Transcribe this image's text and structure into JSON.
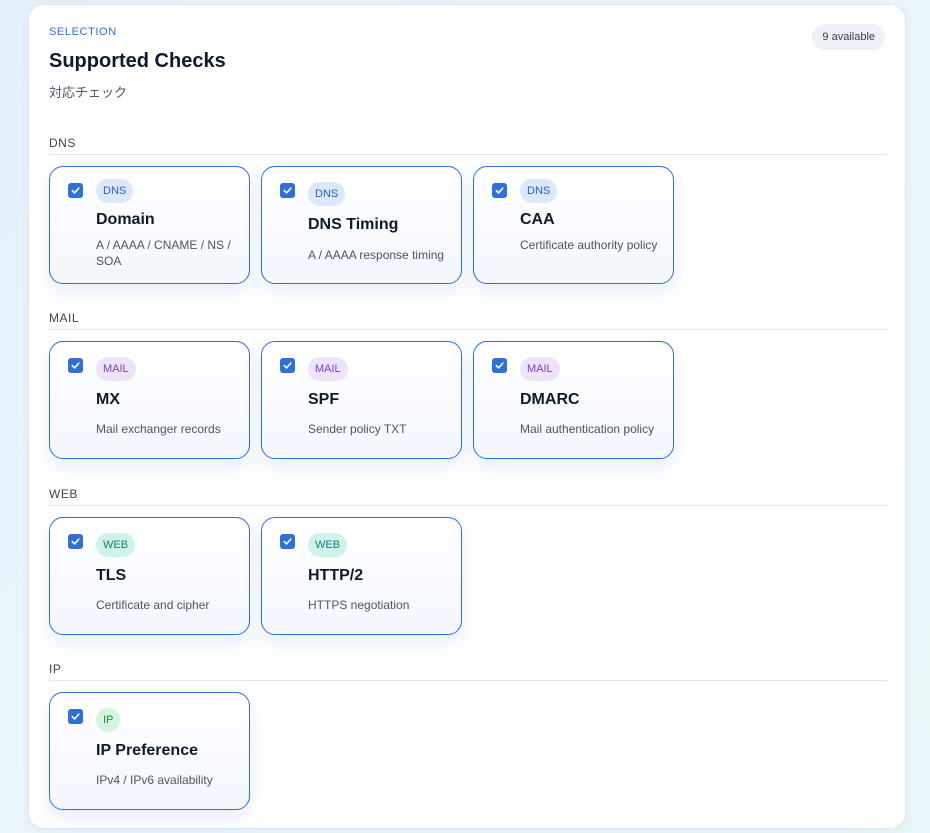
{
  "header": {
    "eyebrow": "SELECTION",
    "title": "Supported Checks",
    "subtitle": "対応チェック",
    "count": "9 available"
  },
  "sections": [
    {
      "label": "DNS",
      "cards": [
        {
          "badge": "DNS",
          "title": "Domain",
          "desc": "A / AAAA / CNAME / NS / SOA",
          "checked": true
        },
        {
          "badge": "DNS",
          "title": "DNS Timing",
          "desc": "A / AAAA response timing",
          "checked": true
        },
        {
          "badge": "DNS",
          "title": "CAA",
          "desc": "Certificate authority policy",
          "checked": true
        }
      ]
    },
    {
      "label": "MAIL",
      "cards": [
        {
          "badge": "MAIL",
          "title": "MX",
          "desc": "Mail exchanger records",
          "checked": true
        },
        {
          "badge": "MAIL",
          "title": "SPF",
          "desc": "Sender policy TXT",
          "checked": true
        },
        {
          "badge": "MAIL",
          "title": "DMARC",
          "desc": "Mail authentication policy",
          "checked": true
        }
      ]
    },
    {
      "label": "WEB",
      "cards": [
        {
          "badge": "WEB",
          "title": "TLS",
          "desc": "Certificate and cipher",
          "checked": true
        },
        {
          "badge": "WEB",
          "title": "HTTP/2",
          "desc": "HTTPS negotiation",
          "checked": true
        }
      ]
    },
    {
      "label": "IP",
      "cards": [
        {
          "badge": "IP",
          "title": "IP Preference",
          "desc": "IPv4 / IPv6 availability",
          "checked": true
        }
      ]
    }
  ]
}
